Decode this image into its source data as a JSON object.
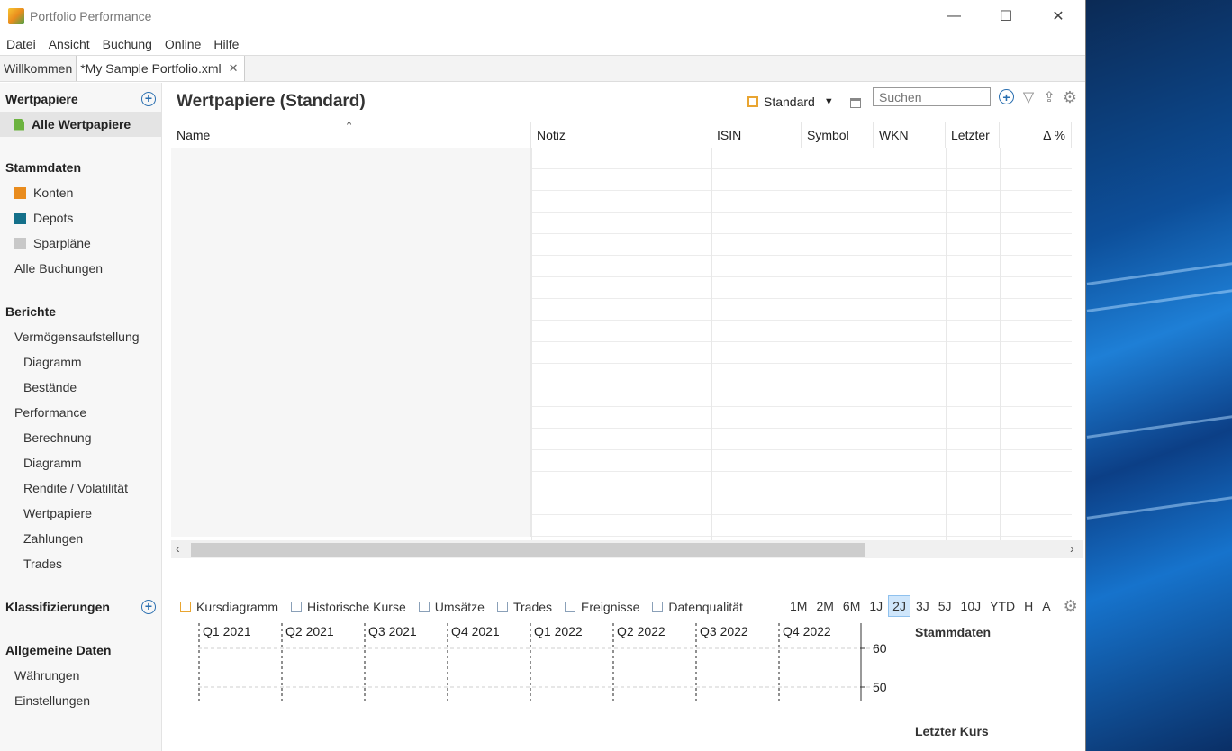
{
  "window": {
    "title": "Portfolio Performance",
    "icon": "portfolio-app-icon"
  },
  "menu": [
    "Datei",
    "Ansicht",
    "Buchung",
    "Online",
    "Hilfe"
  ],
  "tabs": [
    {
      "label": "Willkommen"
    },
    {
      "label": "*My Sample Portfolio.xml",
      "active": true
    }
  ],
  "sidebar": {
    "wertpapiere": {
      "heading": "Wertpapiere",
      "items": [
        "Alle Wertpapiere"
      ]
    },
    "stammdaten": {
      "heading": "Stammdaten",
      "items": [
        "Konten",
        "Depots",
        "Sparpläne",
        "Alle Buchungen"
      ]
    },
    "berichte": {
      "heading": "Berichte",
      "items": [
        "Vermögensaufstellung",
        "Diagramm",
        "Bestände",
        "Performance",
        "Berechnung",
        "Diagramm",
        "Rendite / Volatilität",
        "Wertpapiere",
        "Zahlungen",
        "Trades"
      ]
    },
    "klassifizierungen": {
      "heading": "Klassifizierungen"
    },
    "allgemein": {
      "heading": "Allgemeine Daten",
      "items": [
        "Währungen",
        "Einstellungen"
      ]
    }
  },
  "main": {
    "title": "Wertpapiere (Standard)",
    "view": "Standard",
    "search_placeholder": "Suchen",
    "columns": [
      "Name",
      "Notiz",
      "ISIN",
      "Symbol",
      "WKN",
      "Letzter",
      "Δ %"
    ]
  },
  "bottom": {
    "tabs": [
      "Kursdiagramm",
      "Historische Kurse",
      "Umsätze",
      "Trades",
      "Ereignisse",
      "Datenqualität"
    ],
    "periods": [
      "1M",
      "2M",
      "6M",
      "1J",
      "2J",
      "3J",
      "5J",
      "10J",
      "YTD",
      "H",
      "A"
    ],
    "selected_period": "2J",
    "right_labels": [
      "Stammdaten",
      "Letzter Kurs"
    ]
  },
  "chart_data": {
    "type": "line",
    "x": [
      "Q1 2021",
      "Q2 2021",
      "Q3 2021",
      "Q4 2021",
      "Q1 2022",
      "Q2 2022",
      "Q3 2022",
      "Q4 2022"
    ],
    "y_ticks": [
      60,
      50
    ],
    "series": []
  },
  "colors": {
    "konten": "#e98c1e",
    "depots": "#14708a",
    "sparplaene": "#c8c8c8",
    "alle_wertpapiere": "#6cb33f",
    "accent": "#2a6fb0"
  }
}
